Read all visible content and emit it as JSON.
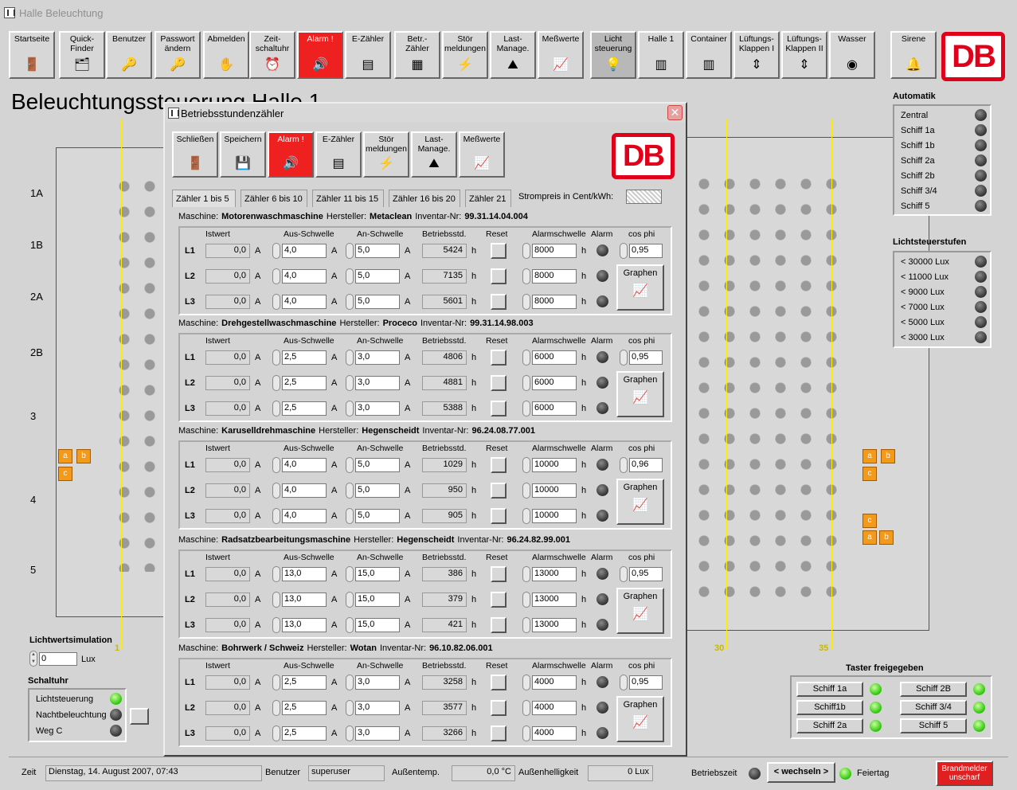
{
  "window": {
    "title": "Halle Beleuchtung"
  },
  "toolbar": [
    {
      "label": "Startseite",
      "icon": "door-icon"
    },
    {
      "label": "Quick-\nFinder",
      "icon": "finder-icon"
    },
    {
      "label": "Benutzer",
      "icon": "keys-icon"
    },
    {
      "label": "Passwort\nändern",
      "icon": "key-icon"
    },
    {
      "label": "Abmelden",
      "icon": "logout-icon"
    },
    {
      "label": "Zeit-\nschaltuhr",
      "icon": "clock-icon"
    },
    {
      "label": "Alarm !",
      "icon": "alarm-icon"
    },
    {
      "label": "E-Zähler",
      "icon": "meter-icon"
    },
    {
      "label": "Betr.-\nZähler",
      "icon": "counter-icon"
    },
    {
      "label": "Stör\nmeldungen",
      "icon": "lightning-icon"
    },
    {
      "label": "Last-\nManage.",
      "icon": "load-icon"
    },
    {
      "label": "Meßwerte",
      "icon": "chart-icon"
    },
    {
      "label": "Licht\nsteuerung",
      "icon": "bulb-icon"
    },
    {
      "label": "Halle 1",
      "icon": "hall-icon"
    },
    {
      "label": "Container",
      "icon": "container-icon"
    },
    {
      "label": "Lüftungs-\nKlappen I",
      "icon": "vent-icon"
    },
    {
      "label": "Lüftungs-\nKlappen II",
      "icon": "vent-icon"
    },
    {
      "label": "Wasser",
      "icon": "water-icon"
    },
    {
      "label": "Sirene",
      "icon": "siren-icon"
    }
  ],
  "logo": "DB",
  "page_title": "Beleuchtungssteuerung Halle 1",
  "rows": [
    "1A",
    "1B",
    "2A",
    "2B",
    "3",
    "4",
    "5"
  ],
  "axis_bottom": [
    "1",
    "30",
    "35"
  ],
  "markers": {
    "a": "a",
    "b": "b",
    "c": "c"
  },
  "automatik": {
    "title": "Automatik",
    "items": [
      "Zentral",
      "Schiff 1a",
      "Schiff 1b",
      "Schiff 2a",
      "Schiff 2b",
      "Schiff 3/4",
      "Schiff 5"
    ]
  },
  "lichtsteuerstufen": {
    "title": "Lichtsteuerstufen",
    "items": [
      "< 30000 Lux",
      "< 11000 Lux",
      "< 9000 Lux",
      "< 7000 Lux",
      "< 5000 Lux",
      "< 3000 Lux"
    ]
  },
  "lichtwert": {
    "title": "Lichtwertsimulation",
    "value": "0",
    "unit": "Lux"
  },
  "schaltuhr": {
    "title": "Schaltuhr",
    "items": [
      "Lichtsteuerung",
      "Nachtbeleuchtung",
      "Weg C"
    ]
  },
  "taster": {
    "title": "Taster freigegeben",
    "buttons": [
      "Schiff 1a",
      "Schiff 2B",
      "Schiff1b",
      "Schiff 3/4",
      "Schiff 2a",
      "Schiff 5"
    ]
  },
  "status": {
    "zeit_label": "Zeit",
    "zeit": "Dienstag, 14. August 2007, 07:43",
    "benutzer_label": "Benutzer",
    "benutzer": "superuser",
    "temp_label": "Außentemp.",
    "temp": "0,0 °C",
    "hell_label": "Außenhelligkeit",
    "hell": "0 Lux",
    "betriebszeit": "Betriebszeit",
    "wechseln": "< wechseln >",
    "feiertag": "Feiertag",
    "brandmelder": "Brandmelder\nunscharf"
  },
  "dialog": {
    "title": "Betriebsstundenzähler",
    "toolbar": [
      {
        "label": "Schließen"
      },
      {
        "label": "Speichern"
      },
      {
        "label": "Alarm !"
      },
      {
        "label": "E-Zähler"
      },
      {
        "label": "Stör\nmeldungen"
      },
      {
        "label": "Last-\nManage."
      },
      {
        "label": "Meßwerte"
      }
    ],
    "tabs": [
      "Zähler 1 bis 5",
      "Zähler 6 bis 10",
      "Zähler 11 bis 15",
      "Zähler 16 bis 20",
      "Zähler 21"
    ],
    "strompreis_label": "Strompreis in Cent/kWh:",
    "headers": {
      "istwert": "Istwert",
      "aus": "Aus-Schwelle",
      "an": "An-Schwelle",
      "betr": "Betriebsstd.",
      "reset": "Reset",
      "alarmschwelle": "Alarmschwelle",
      "alarm": "Alarm",
      "cosphi": "cos phi",
      "graphen": "Graphen",
      "unit_a": "A",
      "unit_h": "h"
    },
    "machines": [
      {
        "label_m": "Maschine:",
        "name": "Motorenwaschmaschine",
        "label_h": "Hersteller:",
        "hersteller": "Metaclean",
        "label_i": "Inventar-Nr:",
        "inventar": "99.31.14.04.004",
        "cosphi": "0,95",
        "lines": [
          {
            "l": "L1",
            "ist": "0,0",
            "aus": "4,0",
            "an": "5,0",
            "betr": "5424",
            "alarm": "8000"
          },
          {
            "l": "L2",
            "ist": "0,0",
            "aus": "4,0",
            "an": "5,0",
            "betr": "7135",
            "alarm": "8000"
          },
          {
            "l": "L3",
            "ist": "0,0",
            "aus": "4,0",
            "an": "5,0",
            "betr": "5601",
            "alarm": "8000"
          }
        ]
      },
      {
        "label_m": "Maschine:",
        "name": "Drehgestellwaschmaschine",
        "label_h": "Hersteller:",
        "hersteller": "Proceco",
        "label_i": "Inventar-Nr:",
        "inventar": "99.31.14.98.003",
        "cosphi": "0,95",
        "lines": [
          {
            "l": "L1",
            "ist": "0,0",
            "aus": "2,5",
            "an": "3,0",
            "betr": "4806",
            "alarm": "6000"
          },
          {
            "l": "L2",
            "ist": "0,0",
            "aus": "2,5",
            "an": "3,0",
            "betr": "4881",
            "alarm": "6000"
          },
          {
            "l": "L3",
            "ist": "0,0",
            "aus": "2,5",
            "an": "3,0",
            "betr": "5388",
            "alarm": "6000"
          }
        ]
      },
      {
        "label_m": "Maschine:",
        "name": "Karuselldrehmaschine",
        "label_h": "Hersteller:",
        "hersteller": "Hegenscheidt",
        "label_i": "Inventar-Nr:",
        "inventar": "96.24.08.77.001",
        "cosphi": "0,96",
        "lines": [
          {
            "l": "L1",
            "ist": "0,0",
            "aus": "4,0",
            "an": "5,0",
            "betr": "1029",
            "alarm": "10000"
          },
          {
            "l": "L2",
            "ist": "0,0",
            "aus": "4,0",
            "an": "5,0",
            "betr": "950",
            "alarm": "10000"
          },
          {
            "l": "L3",
            "ist": "0,0",
            "aus": "4,0",
            "an": "5,0",
            "betr": "905",
            "alarm": "10000"
          }
        ]
      },
      {
        "label_m": "Maschine:",
        "name": "Radsatzbearbeitungsmaschine",
        "label_h": "Hersteller:",
        "hersteller": "Hegenscheidt",
        "label_i": "Inventar-Nr:",
        "inventar": "96.24.82.99.001",
        "cosphi": "0,95",
        "lines": [
          {
            "l": "L1",
            "ist": "0,0",
            "aus": "13,0",
            "an": "15,0",
            "betr": "386",
            "alarm": "13000"
          },
          {
            "l": "L2",
            "ist": "0,0",
            "aus": "13,0",
            "an": "15,0",
            "betr": "379",
            "alarm": "13000"
          },
          {
            "l": "L3",
            "ist": "0,0",
            "aus": "13,0",
            "an": "15,0",
            "betr": "421",
            "alarm": "13000"
          }
        ]
      },
      {
        "label_m": "Maschine:",
        "name": "Bohrwerk / Schweiz",
        "label_h": "Hersteller:",
        "hersteller": "Wotan",
        "label_i": "Inventar-Nr:",
        "inventar": "96.10.82.06.001",
        "cosphi": "0,95",
        "lines": [
          {
            "l": "L1",
            "ist": "0,0",
            "aus": "2,5",
            "an": "3,0",
            "betr": "3258",
            "alarm": "4000"
          },
          {
            "l": "L2",
            "ist": "0,0",
            "aus": "2,5",
            "an": "3,0",
            "betr": "3577",
            "alarm": "4000"
          },
          {
            "l": "L3",
            "ist": "0,0",
            "aus": "2,5",
            "an": "3,0",
            "betr": "3266",
            "alarm": "4000"
          }
        ]
      }
    ]
  },
  "colors": {
    "alarm_red": "#ee2020",
    "db_red": "#e0001a",
    "led_green": "#2bc40a",
    "marker_orange": "#f39a1a"
  }
}
